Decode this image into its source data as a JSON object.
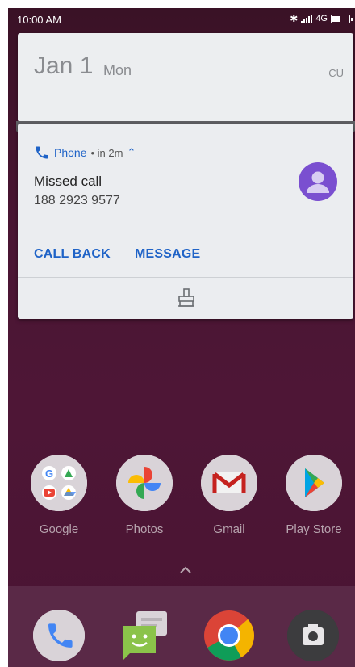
{
  "status_bar": {
    "time": "10:00 AM",
    "network": "4G",
    "battery_level": 0.55
  },
  "date_card": {
    "date": "Jan 1",
    "day": "Mon",
    "carrier": "CU"
  },
  "notification": {
    "app_name": "Phone",
    "time": "• in 2m",
    "title": "Missed call",
    "number": "188 2923 9577",
    "actions": [
      "CALL BACK",
      "MESSAGE"
    ],
    "accent_color": "#1f63c7",
    "avatar_color": "#7a4fd0"
  },
  "apps": [
    {
      "label": "Google",
      "icon": "google-folder-icon"
    },
    {
      "label": "Photos",
      "icon": "photos-icon"
    },
    {
      "label": "Gmail",
      "icon": "gmail-icon"
    },
    {
      "label": "Play Store",
      "icon": "play-store-icon"
    }
  ],
  "dock": [
    {
      "icon": "phone-icon"
    },
    {
      "icon": "messages-icon"
    },
    {
      "icon": "chrome-icon"
    },
    {
      "icon": "camera-icon"
    }
  ]
}
